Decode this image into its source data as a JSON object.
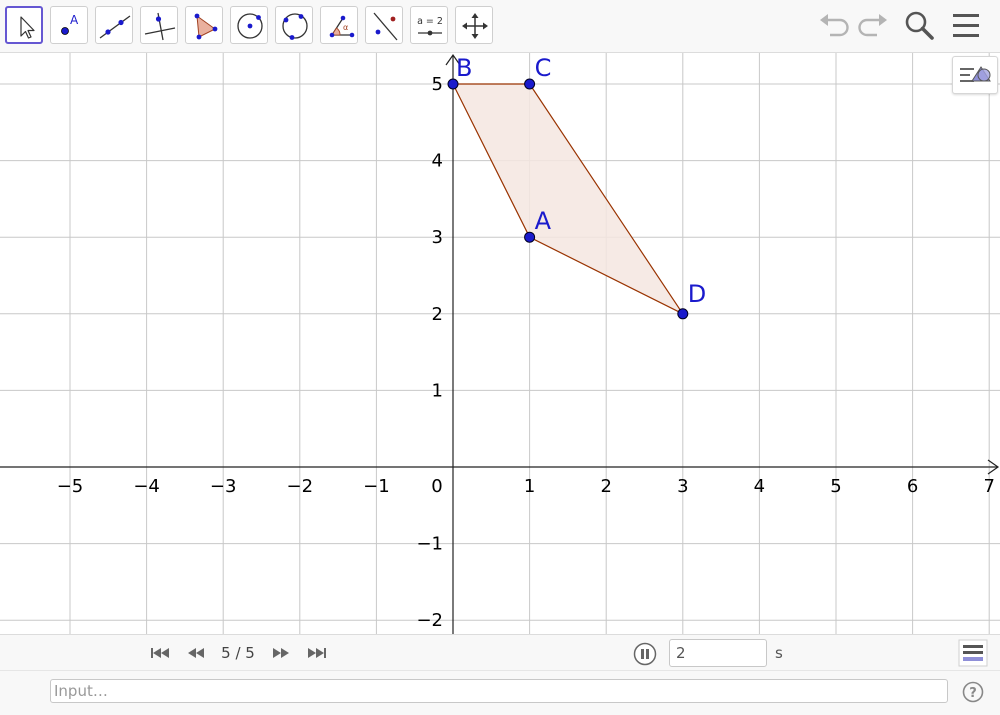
{
  "toolbar": {
    "tools": [
      {
        "name": "move-tool",
        "selected": true
      },
      {
        "name": "point-tool",
        "icon_text": "A"
      },
      {
        "name": "line-tool"
      },
      {
        "name": "perpendicular-line-tool"
      },
      {
        "name": "polygon-tool"
      },
      {
        "name": "circle-with-center-tool"
      },
      {
        "name": "circle-through-3-points-tool"
      },
      {
        "name": "angle-tool",
        "icon_text": "α"
      },
      {
        "name": "reflect-about-line-tool"
      },
      {
        "name": "slider-tool",
        "icon_text": "a = 2"
      },
      {
        "name": "move-graphics-view-tool"
      }
    ],
    "right_icons": [
      "undo-icon",
      "redo-icon",
      "search-icon",
      "menu-icon"
    ]
  },
  "graphics": {
    "x_ticks": [
      "−5",
      "−4",
      "−3",
      "−2",
      "−1",
      "0",
      "1",
      "2",
      "3",
      "4",
      "5",
      "6",
      "7"
    ],
    "y_ticks_pos": [
      "1",
      "2",
      "3",
      "4",
      "5"
    ],
    "y_ticks_neg": [
      "−1",
      "−2"
    ],
    "points": [
      {
        "label": "A",
        "x": 1,
        "y": 3
      },
      {
        "label": "B",
        "x": 0,
        "y": 5
      },
      {
        "label": "C",
        "x": 1,
        "y": 5
      },
      {
        "label": "D",
        "x": 3,
        "y": 2
      }
    ],
    "polygon_order": [
      "B",
      "C",
      "D",
      "A"
    ],
    "colors": {
      "point": "#1a1acc",
      "label": "#1a1acc",
      "polygon_fill": "#f4e6e0",
      "polygon_stroke": "#993300",
      "grid": "#c8c8c8"
    }
  },
  "playbar": {
    "step": "5 / 5",
    "speed_value": "2",
    "speed_unit": "s"
  },
  "inputbar": {
    "placeholder": "Input…"
  }
}
